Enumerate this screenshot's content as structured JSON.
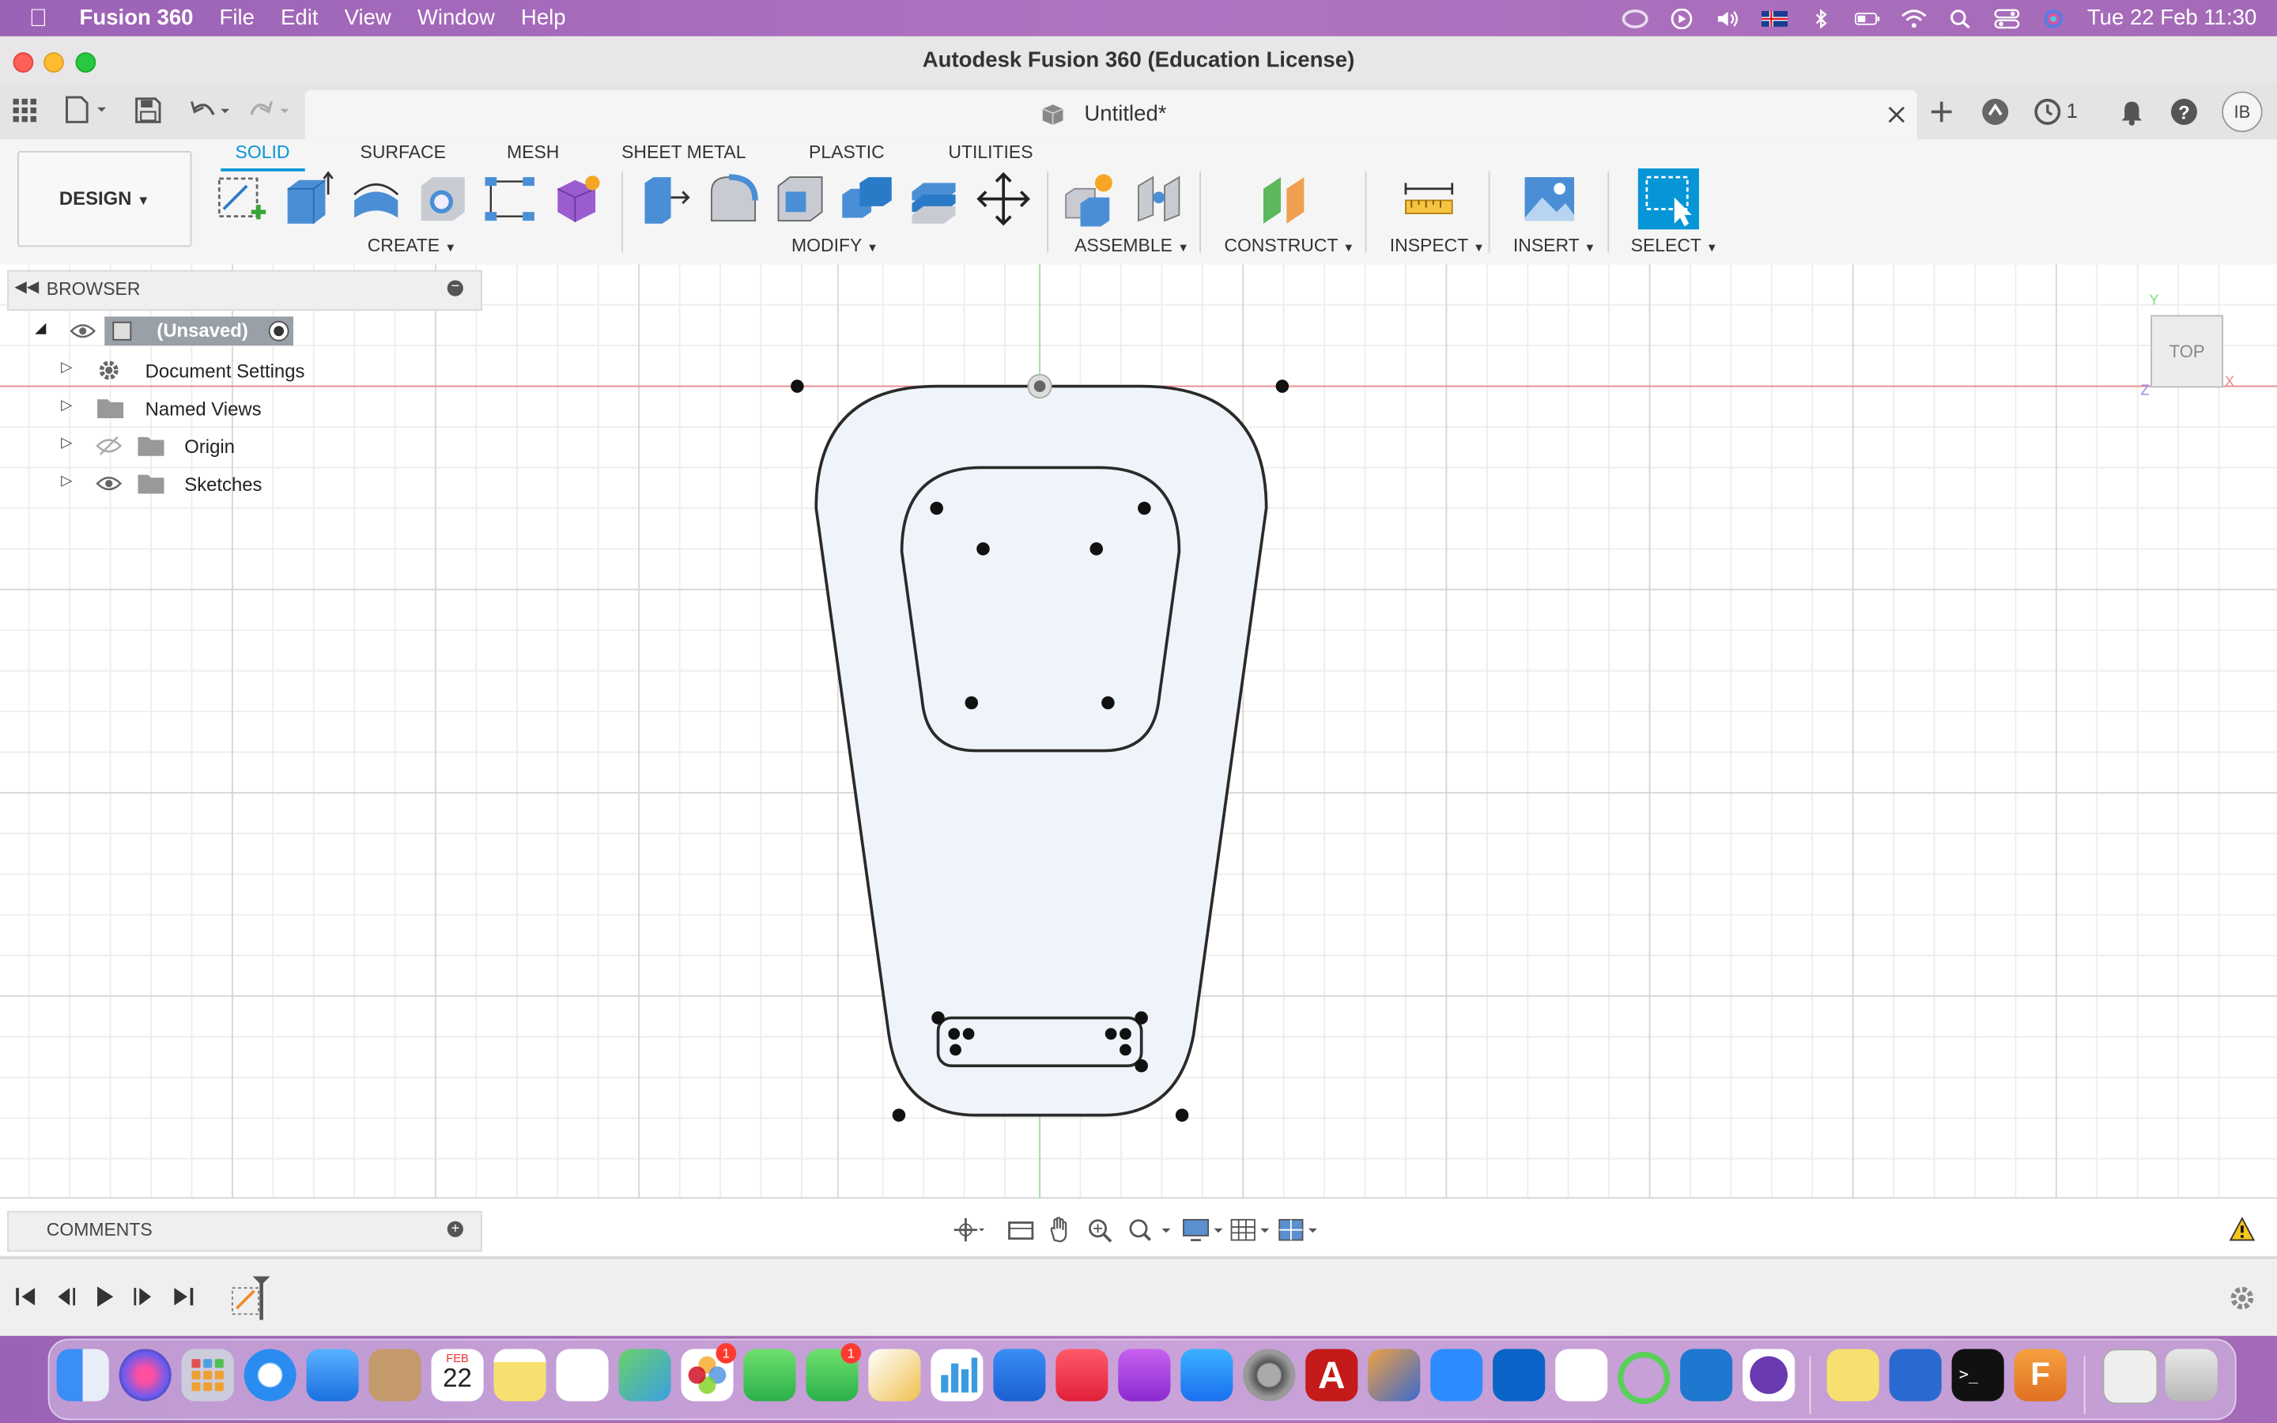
{
  "menubar": {
    "app_name": "Fusion 360",
    "items": [
      "File",
      "Edit",
      "View",
      "Window",
      "Help"
    ],
    "clock": "Tue 22 Feb  11:30"
  },
  "window": {
    "title": "Autodesk Fusion 360 (Education License)"
  },
  "tabbar": {
    "doc_title": "Untitled*",
    "job_count": "1",
    "user_initials": "IB"
  },
  "toolbar": {
    "workspace": "DESIGN",
    "tabs": [
      "SOLID",
      "SURFACE",
      "MESH",
      "SHEET METAL",
      "PLASTIC",
      "UTILITIES"
    ],
    "active_tab": "SOLID",
    "groups": [
      "CREATE",
      "MODIFY",
      "ASSEMBLE",
      "CONSTRUCT",
      "INSPECT",
      "INSERT",
      "SELECT"
    ]
  },
  "browser": {
    "title": "BROWSER",
    "root": "(Unsaved)",
    "items": [
      "Document Settings",
      "Named Views",
      "Origin",
      "Sketches"
    ]
  },
  "comments": {
    "title": "COMMENTS"
  },
  "viewcube": {
    "face": "TOP",
    "axis_y": "Y",
    "axis_x": "X",
    "axis_z": "Z"
  },
  "dock": {
    "calendar_month": "FEB",
    "calendar_day": "22",
    "badge_photos": "1",
    "badge_facetime": "1"
  },
  "colors": {
    "accent": "#0696d7",
    "menubar": "#a96cbc",
    "sketch_fill": "#eef4fa",
    "sketch_line": "#2a2a2a",
    "x_axis": "#e88a8a",
    "y_axis": "#9fdc9f"
  }
}
